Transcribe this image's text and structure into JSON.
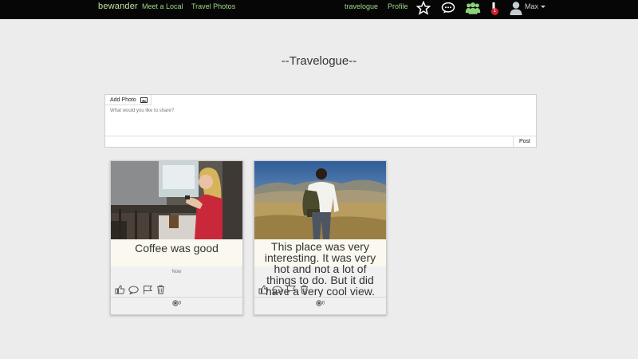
{
  "topbar": {
    "brand": "bewander",
    "nav_left": [
      "Meet a Local",
      "Travel Photos"
    ],
    "nav_right": [
      "travelogue",
      "Profile"
    ],
    "notification_count": "1",
    "user_name": "Max",
    "icons": [
      "star-icon",
      "chat-icon",
      "group-icon",
      "alert-icon",
      "user-icon"
    ]
  },
  "page": {
    "title": "--Travelogue--"
  },
  "composer": {
    "add_photo_label": "Add Photo",
    "placeholder": "What would you like to share?",
    "post_label": "Post"
  },
  "posts": [
    {
      "caption": "Coffee was good",
      "time": "Now",
      "views": "0",
      "actions": [
        "like-icon",
        "comment-icon",
        "flag-icon",
        "delete-icon"
      ]
    },
    {
      "caption": "This place was very interesting. It was very hot and not a lot of things to do. But it did have a very cool view.",
      "views": "0",
      "actions": [
        "like-icon",
        "comment-icon",
        "flag-icon",
        "delete-icon"
      ]
    }
  ],
  "colors": {
    "topbar_bg": "#060606",
    "nav_link": "#9fd98a",
    "badge": "#d7202a",
    "page_bg": "#ececec"
  }
}
